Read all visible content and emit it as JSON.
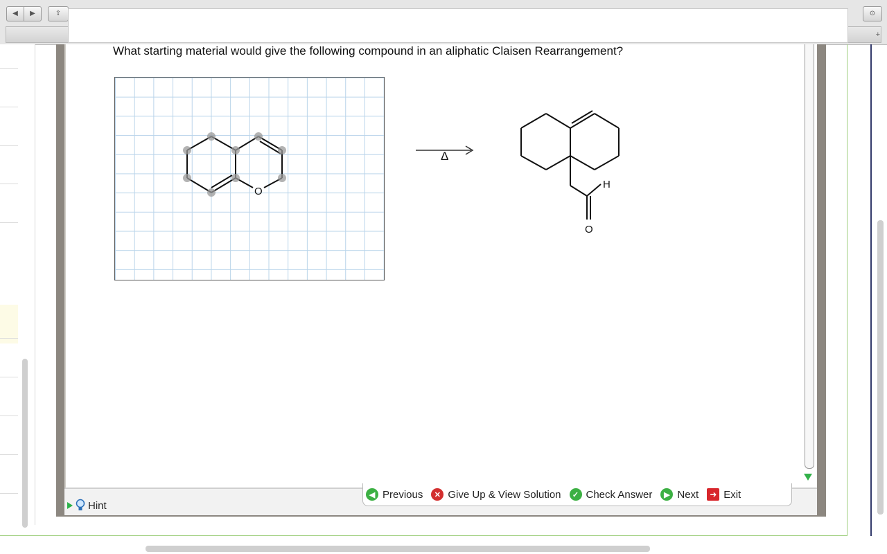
{
  "question": {
    "text": "What starting material would give the following compound in an aliphatic Claisen Rearrangement?"
  },
  "reaction": {
    "heat_symbol": "Δ",
    "left_atom_label": "O",
    "right_atom_labels": {
      "hydrogen": "H",
      "oxygen": "O"
    }
  },
  "toolbar": {
    "hint_label": "Hint",
    "previous_label": "Previous",
    "giveup_label": "Give Up & View Solution",
    "check_label": "Check Answer",
    "next_label": "Next",
    "exit_label": "Exit"
  },
  "browser": {
    "back_glyph": "◀",
    "forward_glyph": "▶",
    "share_glyph": "⇪",
    "download_glyph": "⊙",
    "add_glyph": "+"
  },
  "colors": {
    "grid_line": "#b9d4ea",
    "frame": "#8c8780",
    "accent_green": "#3cb043",
    "accent_red": "#d32f2f"
  }
}
